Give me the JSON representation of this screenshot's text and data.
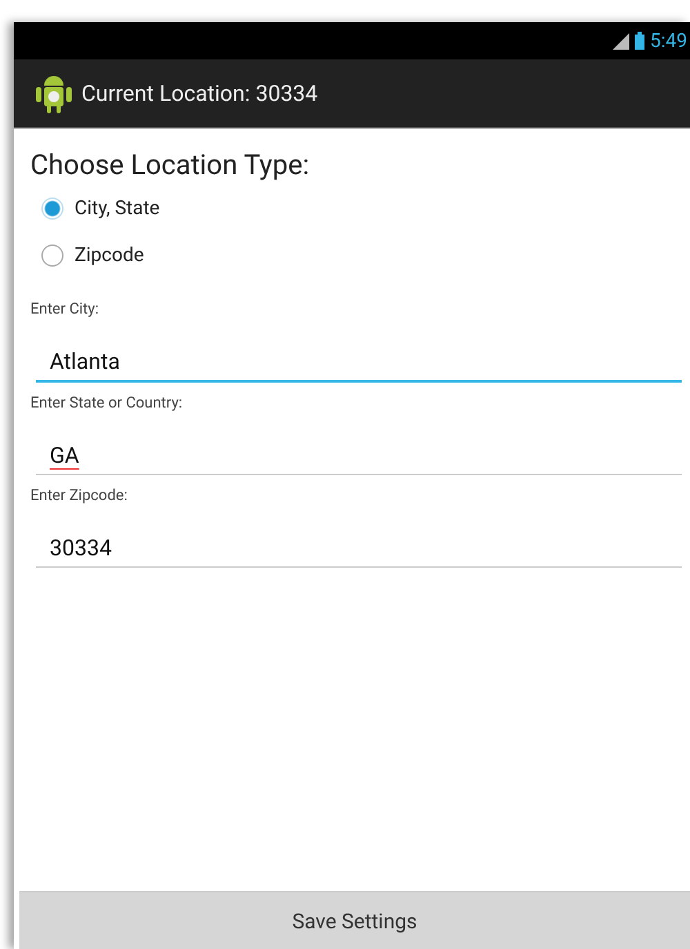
{
  "status_bar": {
    "time": "5:49"
  },
  "action_bar": {
    "title": "Current Location: 30334"
  },
  "heading": "Choose Location Type:",
  "radios": [
    {
      "label": "City, State",
      "selected": true
    },
    {
      "label": "Zipcode",
      "selected": false
    }
  ],
  "fields": [
    {
      "label": "Enter City:",
      "value": "Atlanta",
      "focused": true,
      "misspelled": false
    },
    {
      "label": "Enter State or Country:",
      "value": "GA",
      "focused": false,
      "misspelled": true
    },
    {
      "label": "Enter Zipcode:",
      "value": "30334",
      "focused": false,
      "misspelled": false
    }
  ],
  "button": {
    "label": "Save Settings"
  }
}
